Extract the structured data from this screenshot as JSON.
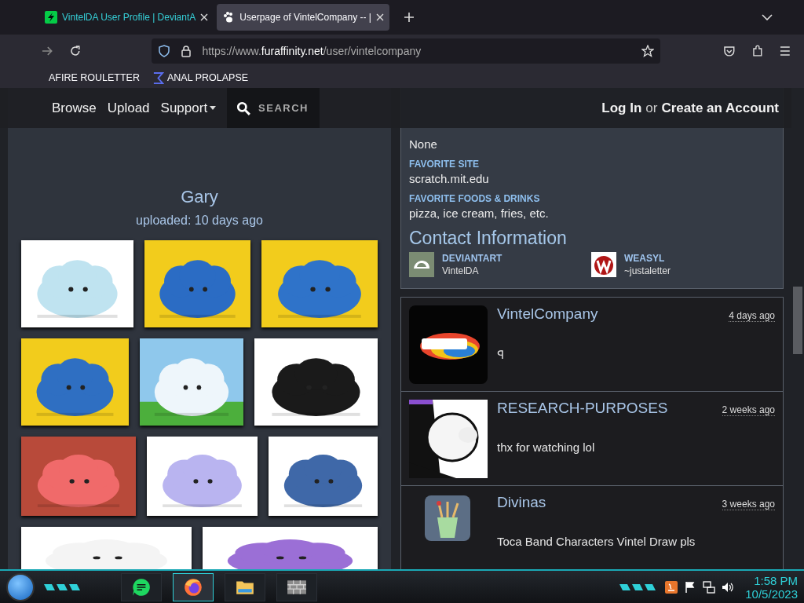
{
  "tabs": [
    {
      "title": "VintelDA User Profile | DeviantA",
      "selected": false
    },
    {
      "title": "Userpage of VintelCompany -- |",
      "selected": true
    }
  ],
  "address_bar": {
    "url": "https://www.**furaffinity.net**/user/vintelcompany"
  },
  "bookmarks": [
    "AFIRE ROULETTER",
    "ANAL PROLAPSE"
  ],
  "site_nav": {
    "links": [
      "Browse",
      "Upload",
      "Support"
    ],
    "search": "SEARCH",
    "login": "Log In",
    "or": "or",
    "signup": "Create an Account"
  },
  "submission": {
    "title": "Gary",
    "uploaded": "uploaded: 10 days ago"
  },
  "gallery": [
    {
      "kind": "picture"
    },
    {
      "kind": "picture"
    },
    {
      "kind": "picture"
    },
    {
      "kind": "picture"
    },
    {
      "kind": "picture"
    },
    {
      "kind": "picture"
    },
    {
      "kind": "picture"
    },
    {
      "kind": "picture"
    },
    {
      "kind": "picture"
    },
    {
      "kind": "picture"
    },
    {
      "kind": "picture"
    }
  ],
  "profile": {
    "fields": [
      {
        "value": "None"
      },
      {
        "label": "FAVORITE SITE",
        "value": "scratch.mit.edu"
      },
      {
        "label": "FAVORITE FOODS & DRINKS",
        "value": "pizza, ice cream, fries, etc."
      }
    ],
    "contact_heading": "Contact Information",
    "contacts": [
      {
        "kind": "deviantart",
        "site": "DEVIANTART",
        "user": "VintelDA"
      },
      {
        "kind": "weasyl",
        "site": "WEASYL",
        "user": "~justaletter"
      }
    ]
  },
  "comments": [
    {
      "user": "VintelCompany",
      "time": "4 days ago",
      "text": "ꟼ",
      "avatar": {
        "kind": "picture"
      }
    },
    {
      "user": "RESEARCH-PURPOSES",
      "time": "2 weeks ago",
      "text": "thx for watching lol",
      "avatar": {
        "kind": "picture"
      }
    },
    {
      "user": "Divinas",
      "time": "3 weeks ago",
      "text": "Toca Band Characters Vintel Draw pls",
      "avatar": {
        "kind": "picture"
      }
    }
  ],
  "taskbar": {
    "apps": [
      {
        "kind": "chat",
        "selected": false
      },
      {
        "kind": "browser",
        "selected": true
      },
      {
        "kind": "folder",
        "selected": false
      },
      {
        "kind": "wall",
        "selected": false
      }
    ],
    "time": "1:58 PM",
    "date": "10/5/2023"
  }
}
